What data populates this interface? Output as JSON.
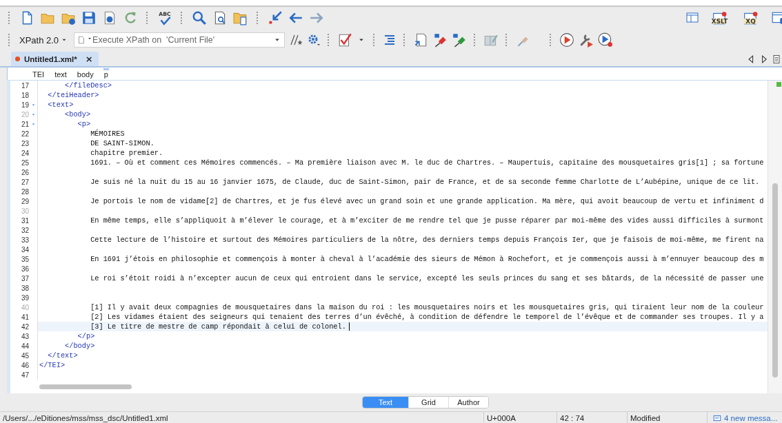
{
  "main_toolbar": {
    "spell_check_badge": "ABC",
    "xslt_debugger_badge": "XSLT",
    "xquery_debugger_badge": "XQ"
  },
  "xpath_toolbar": {
    "version": "XPath 2.0",
    "query_field": {
      "placeholder": "Execute XPath on  'Current File'"
    }
  },
  "editor_tabs": [
    {
      "label": "Untitled1.xml*",
      "selected": true,
      "modified": true,
      "close": "×"
    }
  ],
  "breadcrumb": [
    {
      "label": "TEI",
      "selected": false
    },
    {
      "label": "text",
      "selected": false
    },
    {
      "label": "body",
      "selected": false
    },
    {
      "label": "p",
      "selected": true
    }
  ],
  "lines": [
    {
      "number": "17",
      "text": "      </fileDesc>",
      "kind": "markup",
      "dim": false,
      "foldable": false,
      "current": false
    },
    {
      "number": "18",
      "text": "  </teiHeader>",
      "kind": "markup",
      "dim": false,
      "foldable": false,
      "current": false
    },
    {
      "number": "19",
      "text": "  <text>",
      "kind": "markup",
      "dim": false,
      "foldable": true,
      "current": false
    },
    {
      "number": "20",
      "text": "      <body>",
      "kind": "markup",
      "dim": true,
      "foldable": true,
      "current": false
    },
    {
      "number": "21",
      "text": "         <p>",
      "kind": "markup",
      "dim": false,
      "foldable": true,
      "current": false
    },
    {
      "number": "22",
      "text": "            MÉMOIRES",
      "kind": "text",
      "dim": false,
      "foldable": false,
      "current": false
    },
    {
      "number": "23",
      "text": "            DE SAINT-SIMON.",
      "kind": "text",
      "dim": false,
      "foldable": false,
      "current": false
    },
    {
      "number": "24",
      "text": "            chapitre premier.",
      "kind": "text",
      "dim": false,
      "foldable": false,
      "current": false
    },
    {
      "number": "25",
      "text": "            1691. – Où et comment ces Mémoires commencés. – Ma première liaison avec M. le duc de Chartres. – Maupertuis, capitaine des mousquetaires gris[1] ; sa fortune",
      "kind": "text",
      "dim": false,
      "foldable": false,
      "current": false
    },
    {
      "number": "26",
      "dim": false,
      "foldable": false,
      "current": false
    },
    {
      "number": "27",
      "text": "            Je suis né la nuit du 15 au 16 janvier 1675, de Claude, duc de Saint-Simon, pair de France, et de sa seconde femme Charlotte de L’Aubépine, unique de ce lit.",
      "kind": "text",
      "dim": false,
      "foldable": false,
      "current": false
    },
    {
      "number": "28",
      "dim": false,
      "foldable": false,
      "current": false
    },
    {
      "number": "29",
      "text": "            Je portois le nom de vidame[2] de Chartres, et je fus élevé avec un grand soin et une grande application. Ma mère, qui avoit beaucoup de vertu et infiniment d",
      "kind": "text",
      "dim": false,
      "foldable": false,
      "current": false
    },
    {
      "number": "30",
      "dim": true,
      "foldable": false,
      "current": false
    },
    {
      "number": "31",
      "text": "            En même temps, elle s’appliquoit à m’élever le courage, et à m’exciter de me rendre tel que je pusse réparer par moi-même des vides aussi difficiles à surmont",
      "kind": "text",
      "dim": false,
      "foldable": false,
      "current": false
    },
    {
      "number": "32",
      "dim": false,
      "foldable": false,
      "current": false
    },
    {
      "number": "33",
      "text": "            Cette lecture de l’histoire et surtout des Mémoires particuliers de la nôtre, des derniers temps depuis François Ier, que je faisois de moi-même, me firent na",
      "kind": "text",
      "dim": false,
      "foldable": false,
      "current": false
    },
    {
      "number": "34",
      "dim": false,
      "foldable": false,
      "current": false
    },
    {
      "number": "35",
      "text": "            En 1691 j’étois en philosophie et commençois à monter à cheval à l’académie des sieurs de Mémon à Rochefort, et je commençois aussi à m’ennuyer beaucoup des m",
      "kind": "text",
      "dim": false,
      "foldable": false,
      "current": false
    },
    {
      "number": "36",
      "dim": false,
      "foldable": false,
      "current": false
    },
    {
      "number": "37",
      "text": "            Le roi s’étoit roidi à n’excepter aucun de ceux qui entroient dans le service, excepté les seuls princes du sang et ses bâtards, de la nécessité de passer une",
      "kind": "text",
      "dim": false,
      "foldable": false,
      "current": false
    },
    {
      "number": "38",
      "dim": false,
      "foldable": false,
      "current": false
    },
    {
      "number": "39",
      "dim": false,
      "foldable": false,
      "current": false
    },
    {
      "number": "40",
      "text": "            [1] Il y avait deux compagnies de mousquetaires dans la maison du roi : les mousquetaires noirs et les mousquetaires gris, qui tiraient leur nom de la couleur",
      "kind": "text",
      "dim": true,
      "foldable": false,
      "current": false
    },
    {
      "number": "41",
      "text": "            [2] Les vidames étaient des seigneurs qui tenaient des terres d’un évêché, à condition de défendre le temporel de l’évêque et de commander ses troupes. Il y a",
      "kind": "text",
      "dim": false,
      "foldable": false,
      "current": false
    },
    {
      "number": "42",
      "text": "            [3] Le titre de mestre de camp répondait à celui de colonel.",
      "kind": "text",
      "dim": false,
      "foldable": false,
      "current": true
    },
    {
      "number": "43",
      "text": "         </p>",
      "kind": "markup",
      "dim": false,
      "foldable": false,
      "current": false
    },
    {
      "number": "44",
      "text": "      </body>",
      "kind": "markup",
      "dim": false,
      "foldable": false,
      "current": false
    },
    {
      "number": "45",
      "text": "  </text>",
      "kind": "markup",
      "dim": false,
      "foldable": false,
      "current": false
    },
    {
      "number": "46",
      "text": "</TEI>",
      "kind": "markup",
      "dim": false,
      "foldable": false,
      "current": false
    },
    {
      "number": "47",
      "dim": false,
      "foldable": false,
      "current": false
    }
  ],
  "mode_tabs": [
    {
      "label": "Text",
      "selected": true
    },
    {
      "label": "Grid",
      "selected": false
    },
    {
      "label": "Author",
      "selected": false
    }
  ],
  "status_bar": {
    "path": "/Users/.../eDitiones/mss/mss_dsc/Untitled1.xml",
    "character": "U+000A",
    "position": "42 : 74",
    "state": "Modified",
    "messages": "4 new messa..."
  }
}
